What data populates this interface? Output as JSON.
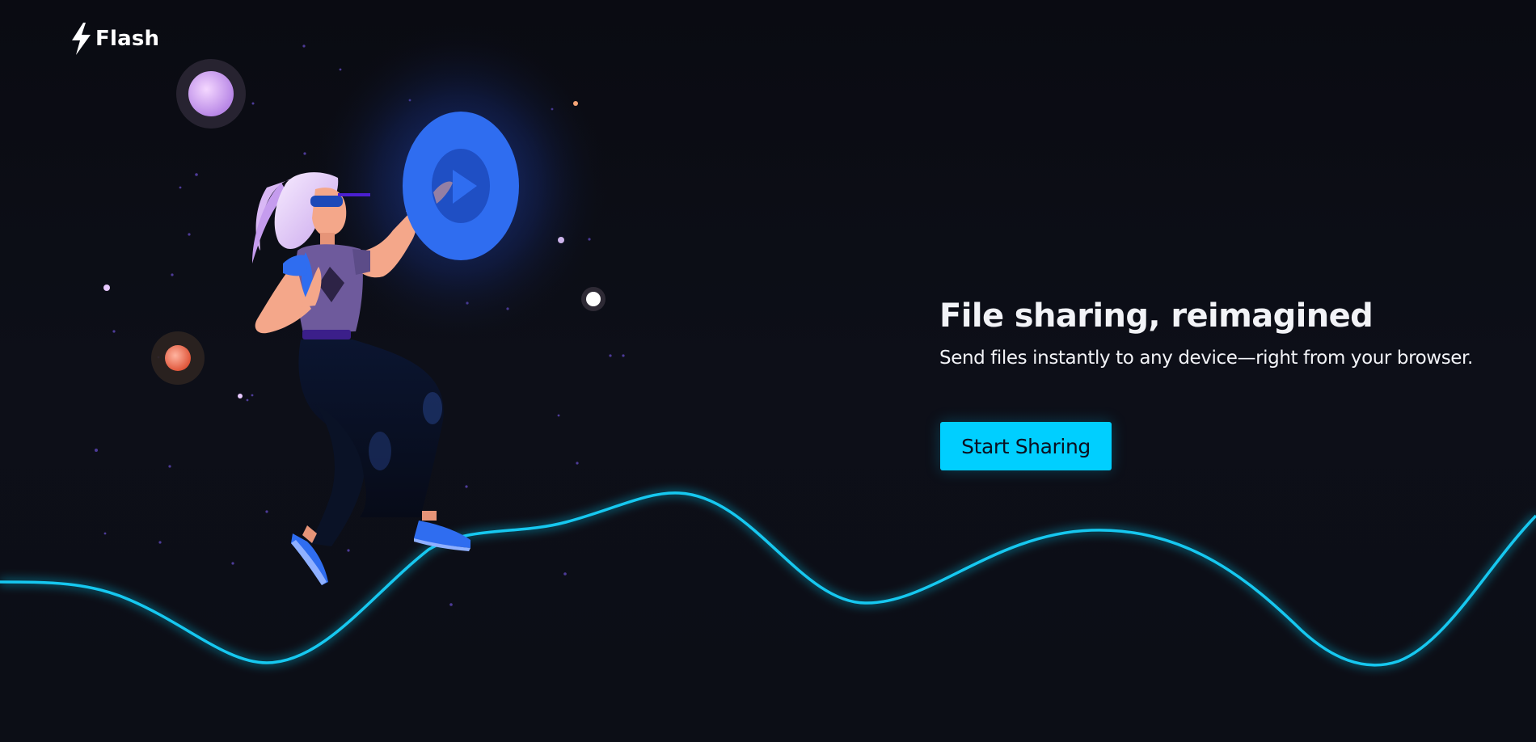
{
  "brand": {
    "name": "Flash",
    "icon": "lightning-bolt-icon"
  },
  "hero": {
    "title": "File sharing, reimagined",
    "subtitle": "Send files instantly to any device—right from your browser.",
    "cta_label": "Start Sharing"
  },
  "illustration": {
    "subject": "astronaut-woman-floating",
    "held_object": "play-icon"
  },
  "colors": {
    "background": "#0c0e16",
    "accent": "#00cfff",
    "wave": "#18c8f0",
    "disc": "#2f6df0"
  }
}
